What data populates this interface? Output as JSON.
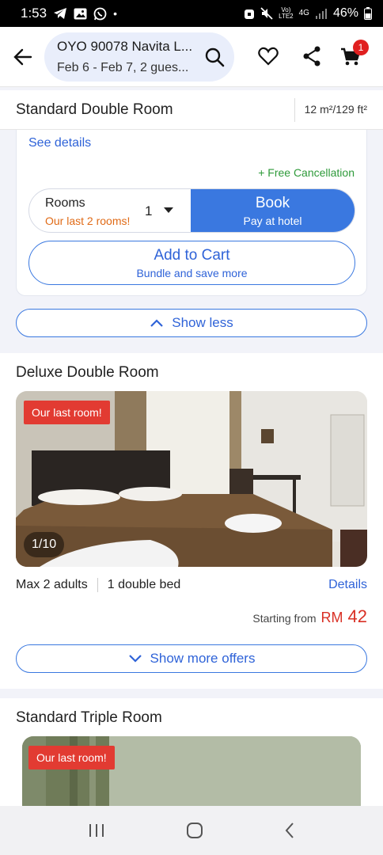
{
  "status_bar": {
    "time": "1:53",
    "network_top": "Vo)",
    "network_bottom": "LTE2",
    "net_type": "4G",
    "battery": "46%"
  },
  "header": {
    "hotel_name": "OYO 90078 Navita L...",
    "dates_guests": "Feb 6 - Feb 7, 2 gues...",
    "cart_count": "1",
    "icons": [
      "back-arrow-icon",
      "search-icon",
      "heart-icon",
      "share-icon",
      "cart-icon"
    ]
  },
  "standard_double": {
    "title": "Standard Double Room",
    "size": "12 m²/129 ft²",
    "see_details": "See details",
    "free_cancellation": "+ Free Cancellation",
    "rooms_label": "Rooms",
    "rooms_warning": "Our last 2 rooms!",
    "rooms_qty": "1",
    "book_label": "Book",
    "book_sub": "Pay at hotel",
    "cart_label": "Add to Cart",
    "cart_sub": "Bundle and save more",
    "show_less": "Show less"
  },
  "deluxe_double": {
    "title": "Deluxe Double Room",
    "tag": "Our last room!",
    "photo_counter": "1/10",
    "occupancy": "Max 2 adults",
    "bed": "1 double bed",
    "details": "Details",
    "starting_from": "Starting from",
    "currency": "RM",
    "price": "42",
    "show_more": "Show more offers"
  },
  "standard_triple": {
    "title": "Standard Triple Room",
    "tag": "Our last room!"
  },
  "colors": {
    "accent_blue": "#3a78e0",
    "link_blue": "#2f63d8",
    "price_red": "#d93025",
    "warn_orange": "#e06a16",
    "green": "#2e9a3a"
  }
}
